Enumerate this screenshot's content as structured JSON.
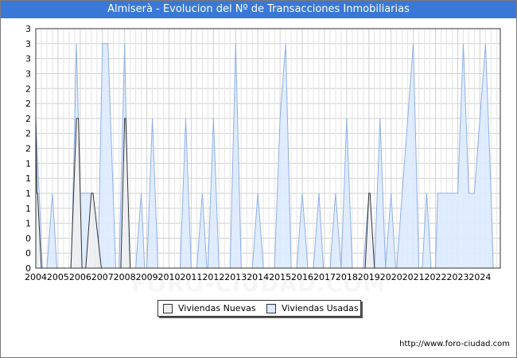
{
  "header": {
    "title": "Almiserà - Evolucion del Nº de Transacciones Inmobiliarias"
  },
  "watermark": "FORO-CIUDAD.COM",
  "footer": {
    "url": "http://www.foro-ciudad.com"
  },
  "legend": [
    {
      "label": "Viviendas Nuevas",
      "color": "#f0f0f0"
    },
    {
      "label": "Viviendas Usadas",
      "color": "#ddeaff"
    }
  ],
  "colors": {
    "title_bg": "#3a78d8",
    "used_fill": "#ddeaff",
    "used_stroke": "#8fb0e8",
    "new_fill": "#f0f0f0",
    "new_stroke": "#333333",
    "grid": "#d0d0d0"
  },
  "chart_data": {
    "type": "area",
    "title": "Almiserà - Evolucion del Nº de Transacciones Inmobiliarias",
    "xlabel": "",
    "ylabel": "",
    "x_ticks": [
      "2004",
      "2005",
      "2006",
      "2007",
      "2008",
      "2009",
      "2010",
      "2011",
      "2012",
      "2013",
      "2014",
      "2015",
      "2016",
      "2017",
      "2018",
      "2019",
      "2020",
      "2021",
      "2022",
      "2023",
      "2024"
    ],
    "y_ticks": [
      "0",
      "0",
      "0",
      "1",
      "1",
      "1",
      "1",
      "1",
      "2",
      "2",
      "2",
      "2",
      "2",
      "3",
      "3",
      "3",
      "3"
    ],
    "ylim": [
      0,
      3.2
    ],
    "xlim": [
      2004,
      2024.917
    ],
    "grid": true,
    "legend_position": "bottom",
    "series": [
      {
        "name": "Viviendas Nuevas",
        "points": [
          [
            2004.0,
            2.0
          ],
          [
            2004.05,
            1.0
          ],
          [
            2004.08,
            1.0
          ],
          [
            2004.25,
            0
          ],
          [
            2005.58,
            0
          ],
          [
            2005.83,
            2.0
          ],
          [
            2005.92,
            2.0
          ],
          [
            2006.08,
            0
          ],
          [
            2006.25,
            0
          ],
          [
            2006.5,
            1.0
          ],
          [
            2006.58,
            1.0
          ],
          [
            2006.95,
            0
          ],
          [
            2007.83,
            0
          ],
          [
            2008.0,
            2.0
          ],
          [
            2008.05,
            2.0
          ],
          [
            2008.25,
            0
          ],
          [
            2018.83,
            0
          ],
          [
            2019.0,
            1.0
          ],
          [
            2019.05,
            1.0
          ],
          [
            2019.25,
            0
          ]
        ]
      },
      {
        "name": "Viviendas Usadas",
        "points": [
          [
            2004.0,
            2.0
          ],
          [
            2004.3,
            0
          ],
          [
            2004.5,
            0
          ],
          [
            2004.75,
            1.0
          ],
          [
            2004.95,
            0
          ],
          [
            2005.6,
            0
          ],
          [
            2005.83,
            3.0
          ],
          [
            2006.0,
            1.0
          ],
          [
            2006.55,
            1.0
          ],
          [
            2006.7,
            0
          ],
          [
            2006.8,
            0
          ],
          [
            2007.0,
            3.0
          ],
          [
            2007.25,
            3.0
          ],
          [
            2007.6,
            0
          ],
          [
            2007.75,
            0
          ],
          [
            2008.0,
            3.0
          ],
          [
            2008.2,
            0
          ],
          [
            2008.5,
            0
          ],
          [
            2008.75,
            1.0
          ],
          [
            2008.9,
            0
          ],
          [
            2009.0,
            0
          ],
          [
            2009.25,
            2.0
          ],
          [
            2009.5,
            0
          ],
          [
            2010.5,
            0
          ],
          [
            2010.75,
            2.0
          ],
          [
            2011.0,
            0
          ],
          [
            2011.25,
            0
          ],
          [
            2011.5,
            1.0
          ],
          [
            2011.7,
            0
          ],
          [
            2011.75,
            0
          ],
          [
            2012.0,
            2.0
          ],
          [
            2012.25,
            0
          ],
          [
            2012.75,
            0
          ],
          [
            2013.0,
            3.0
          ],
          [
            2013.25,
            0
          ],
          [
            2013.75,
            0
          ],
          [
            2014.0,
            1.0
          ],
          [
            2014.25,
            0
          ],
          [
            2014.75,
            0
          ],
          [
            2015.0,
            2.0
          ],
          [
            2015.25,
            3.0
          ],
          [
            2015.5,
            0
          ],
          [
            2015.75,
            0
          ],
          [
            2016.0,
            1.0
          ],
          [
            2016.25,
            0
          ],
          [
            2016.5,
            0
          ],
          [
            2016.75,
            1.0
          ],
          [
            2016.95,
            0
          ],
          [
            2017.25,
            0
          ],
          [
            2017.5,
            1.0
          ],
          [
            2017.75,
            0
          ],
          [
            2017.75,
            0
          ],
          [
            2018.0,
            2.0
          ],
          [
            2018.25,
            0
          ],
          [
            2018.75,
            0
          ],
          [
            2019.0,
            1.0
          ],
          [
            2019.25,
            0
          ],
          [
            2019.25,
            0
          ],
          [
            2019.5,
            2.0
          ],
          [
            2019.75,
            0
          ],
          [
            2019.75,
            0
          ],
          [
            2020.0,
            1.0
          ],
          [
            2020.2,
            0
          ],
          [
            2020.25,
            0
          ],
          [
            2021.0,
            3.0
          ],
          [
            2021.25,
            0
          ],
          [
            2021.4,
            0
          ],
          [
            2021.6,
            1.0
          ],
          [
            2021.8,
            0
          ],
          [
            2022.0,
            0
          ],
          [
            2022.1,
            1.0
          ],
          [
            2023.0,
            1.0
          ],
          [
            2023.25,
            3.0
          ],
          [
            2023.5,
            1.0
          ],
          [
            2023.75,
            1.0
          ],
          [
            2024.25,
            3.0
          ],
          [
            2024.5,
            1.0
          ],
          [
            2024.6,
            0
          ]
        ]
      }
    ]
  }
}
